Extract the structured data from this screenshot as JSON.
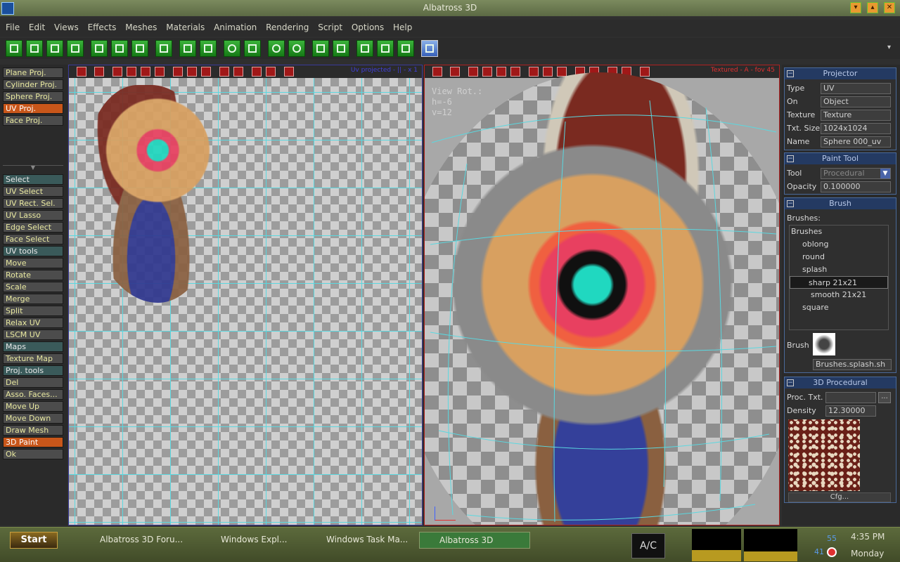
{
  "window": {
    "title": "Albatross 3D"
  },
  "menu": [
    "File",
    "Edit",
    "Views",
    "Effects",
    "Meshes",
    "Materials",
    "Animation",
    "Rendering",
    "Script",
    "Options",
    "Help"
  ],
  "left_panel": {
    "projections": [
      {
        "label": "Plane Proj.",
        "active": false
      },
      {
        "label": "Cylinder Proj.",
        "active": false
      },
      {
        "label": "Sphere Proj.",
        "active": false
      },
      {
        "label": "UV Proj.",
        "active": true
      },
      {
        "label": "Face Proj.",
        "active": false
      }
    ],
    "tools": [
      {
        "label": "Select",
        "kind": "hdr"
      },
      {
        "label": "UV Select",
        "kind": "btn"
      },
      {
        "label": "UV Rect. Sel.",
        "kind": "btn"
      },
      {
        "label": "UV Lasso",
        "kind": "btn"
      },
      {
        "label": "Edge Select",
        "kind": "btn"
      },
      {
        "label": "Face Select",
        "kind": "btn"
      },
      {
        "label": "UV tools",
        "kind": "hdr"
      },
      {
        "label": "Move",
        "kind": "btn"
      },
      {
        "label": "Rotate",
        "kind": "btn"
      },
      {
        "label": "Scale",
        "kind": "btn"
      },
      {
        "label": "Merge",
        "kind": "btn"
      },
      {
        "label": "Split",
        "kind": "btn"
      },
      {
        "label": "Relax UV",
        "kind": "btn"
      },
      {
        "label": "LSCM UV",
        "kind": "btn"
      },
      {
        "label": "Maps",
        "kind": "hdr"
      },
      {
        "label": "Texture Map",
        "kind": "btn"
      },
      {
        "label": "Proj. tools",
        "kind": "hdr"
      },
      {
        "label": "Del",
        "kind": "btn"
      },
      {
        "label": "Asso. Faces...",
        "kind": "btn"
      },
      {
        "label": "Move Up",
        "kind": "btn"
      },
      {
        "label": "Move Down",
        "kind": "btn"
      },
      {
        "label": "Draw Mesh",
        "kind": "btn"
      },
      {
        "label": "3D Paint",
        "kind": "act"
      },
      {
        "label": "Ok",
        "kind": "btn"
      }
    ]
  },
  "viewport_left": {
    "label": "Uv projected - || - x 1"
  },
  "viewport_right": {
    "label": "Textured - A - fov 45",
    "view_rot": "View Rot.:",
    "h": "h=-6",
    "v": "v=12"
  },
  "projector": {
    "title": "Projector",
    "rows": [
      {
        "label": "Type",
        "value": "UV"
      },
      {
        "label": "On",
        "value": "Object"
      },
      {
        "label": "Texture",
        "value": "Texture"
      },
      {
        "label": "Txt. Size",
        "value": "1024x1024"
      },
      {
        "label": "Name",
        "value": "Sphere 000_uv"
      }
    ]
  },
  "paint_tool": {
    "title": "Paint Tool",
    "tool_label": "Tool",
    "tool_value": "Procedural",
    "opacity_label": "Opacity",
    "opacity_value": "0.100000"
  },
  "brush": {
    "title": "Brush",
    "brushes_label": "Brushes:",
    "tree": [
      {
        "label": "Brushes",
        "level": 0
      },
      {
        "label": "oblong",
        "level": 1
      },
      {
        "label": "round",
        "level": 1
      },
      {
        "label": "splash",
        "level": 1
      },
      {
        "label": "sharp 21x21",
        "level": 2,
        "selected": true
      },
      {
        "label": "smooth 21x21",
        "level": 2
      },
      {
        "label": "square",
        "level": 1
      }
    ],
    "brush_label": "Brush",
    "brush_path": "Brushes.splash.sh"
  },
  "procedural": {
    "title": "3D Procedural",
    "proc_label": "Proc. Txt.",
    "proc_value": "",
    "density_label": "Density",
    "density_value": "12.30000",
    "cfg_label": "Cfg..."
  },
  "taskbar": {
    "start": "Start",
    "tasks": [
      "Albatross 3D Foru...",
      "Windows Expl...",
      "Windows Task Ma...",
      "Albatross 3D"
    ],
    "ac": "A/C",
    "tray_a": "55",
    "tray_b": "41",
    "time": "4:35 PM",
    "day": "Monday"
  },
  "colors": {
    "accent": "#c8561a",
    "panel_header": "#243a62",
    "grid": "#5ad8e0"
  }
}
